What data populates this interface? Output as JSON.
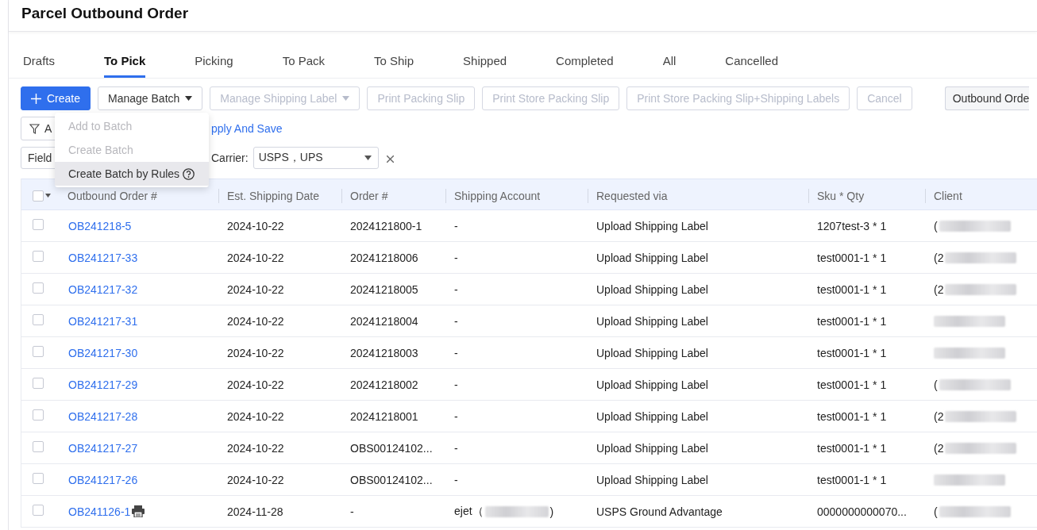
{
  "title": "Parcel Outbound Order",
  "tabs": [
    {
      "label": "Drafts",
      "selected": false
    },
    {
      "label": "To Pick",
      "selected": true
    },
    {
      "label": "Picking",
      "selected": false
    },
    {
      "label": "To Pack",
      "selected": false
    },
    {
      "label": "To Ship",
      "selected": false
    },
    {
      "label": "Shipped",
      "selected": false
    },
    {
      "label": "Completed",
      "selected": false
    },
    {
      "label": "All",
      "selected": false
    },
    {
      "label": "Cancelled",
      "selected": false
    }
  ],
  "toolbar": [
    {
      "label": "Create",
      "kind": "primary",
      "disabled": false
    },
    {
      "label": "Manage Batch",
      "kind": "dropdown",
      "disabled": false
    },
    {
      "label": "Manage Shipping Label",
      "kind": "dropdown",
      "disabled": true
    },
    {
      "label": "Print Packing Slip",
      "kind": "button",
      "disabled": true
    },
    {
      "label": "Print Store Packing Slip",
      "kind": "button",
      "disabled": true
    },
    {
      "label": "Print Store Packing Slip+Shipping Labels",
      "kind": "button",
      "disabled": true
    },
    {
      "label": "Cancel",
      "kind": "button",
      "disabled": true
    }
  ],
  "export_button": {
    "label": "Outbound Orde"
  },
  "filter": {
    "button_label": "A",
    "link": "pply And Save"
  },
  "field_select": {
    "label": "Field"
  },
  "carrier": {
    "label": "Carrier:",
    "value": "USPS，UPS"
  },
  "batch_menu": [
    {
      "label": "Add to Batch",
      "disabled": true,
      "selected": false,
      "help": false
    },
    {
      "label": "Create Batch",
      "disabled": true,
      "selected": false,
      "help": false
    },
    {
      "label": "Create Batch by Rules",
      "disabled": false,
      "selected": true,
      "help": true
    }
  ],
  "table": {
    "columns": [
      "Outbound Order #",
      "Est. Shipping Date",
      "Order #",
      "Shipping Account",
      "Requested via",
      "Sku * Qty",
      "Client"
    ],
    "all_checked": false,
    "rows": [
      {
        "order": "OB241218-5",
        "printed": false,
        "date": "2024-10-22",
        "order_no": "2024121800-1",
        "account": "-",
        "account_end": "",
        "via": "Upload Shipping Label",
        "sku": "1207test-3 * 1",
        "client": "(",
        "checked": false
      },
      {
        "order": "OB241217-33",
        "printed": false,
        "date": "2024-10-22",
        "order_no": "20241218006",
        "account": "-",
        "account_end": "",
        "via": "Upload Shipping Label",
        "sku": "test0001-1 * 1",
        "client": "(2",
        "checked": false
      },
      {
        "order": "OB241217-32",
        "printed": false,
        "date": "2024-10-22",
        "order_no": "20241218005",
        "account": "-",
        "account_end": "",
        "via": "Upload Shipping Label",
        "sku": "test0001-1 * 1",
        "client": "(2",
        "checked": false
      },
      {
        "order": "OB241217-31",
        "printed": false,
        "date": "2024-10-22",
        "order_no": "20241218004",
        "account": "-",
        "account_end": "",
        "via": "Upload Shipping Label",
        "sku": "test0001-1 * 1",
        "client": "",
        "checked": false
      },
      {
        "order": "OB241217-30",
        "printed": false,
        "date": "2024-10-22",
        "order_no": "20241218003",
        "account": "-",
        "account_end": "",
        "via": "Upload Shipping Label",
        "sku": "test0001-1 * 1",
        "client": "",
        "checked": false
      },
      {
        "order": "OB241217-29",
        "printed": false,
        "date": "2024-10-22",
        "order_no": "20241218002",
        "account": "-",
        "account_end": "",
        "via": "Upload Shipping Label",
        "sku": "test0001-1 * 1",
        "client": "(",
        "checked": false
      },
      {
        "order": "OB241217-28",
        "printed": false,
        "date": "2024-10-22",
        "order_no": "20241218001",
        "account": "-",
        "account_end": "",
        "via": "Upload Shipping Label",
        "sku": "test0001-1 * 1",
        "client": "(2",
        "checked": false
      },
      {
        "order": "OB241217-27",
        "printed": false,
        "date": "2024-10-22",
        "order_no": "OBS00124102...",
        "account": "-",
        "account_end": "",
        "via": "Upload Shipping Label",
        "sku": "test0001-1 * 1",
        "client": "(2",
        "checked": false
      },
      {
        "order": "OB241217-26",
        "printed": false,
        "date": "2024-10-22",
        "order_no": "OBS00124102...",
        "account": "-",
        "account_end": "",
        "via": "Upload Shipping Label",
        "sku": "test0001-1 * 1",
        "client": "",
        "checked": false
      },
      {
        "order": "OB241126-1",
        "printed": true,
        "date": "2024-11-28",
        "order_no": "-",
        "account": "ejet（",
        "account_end": ")",
        "via": "USPS Ground Advantage",
        "sku": "0000000000070...",
        "client": "(",
        "checked": false
      }
    ]
  }
}
